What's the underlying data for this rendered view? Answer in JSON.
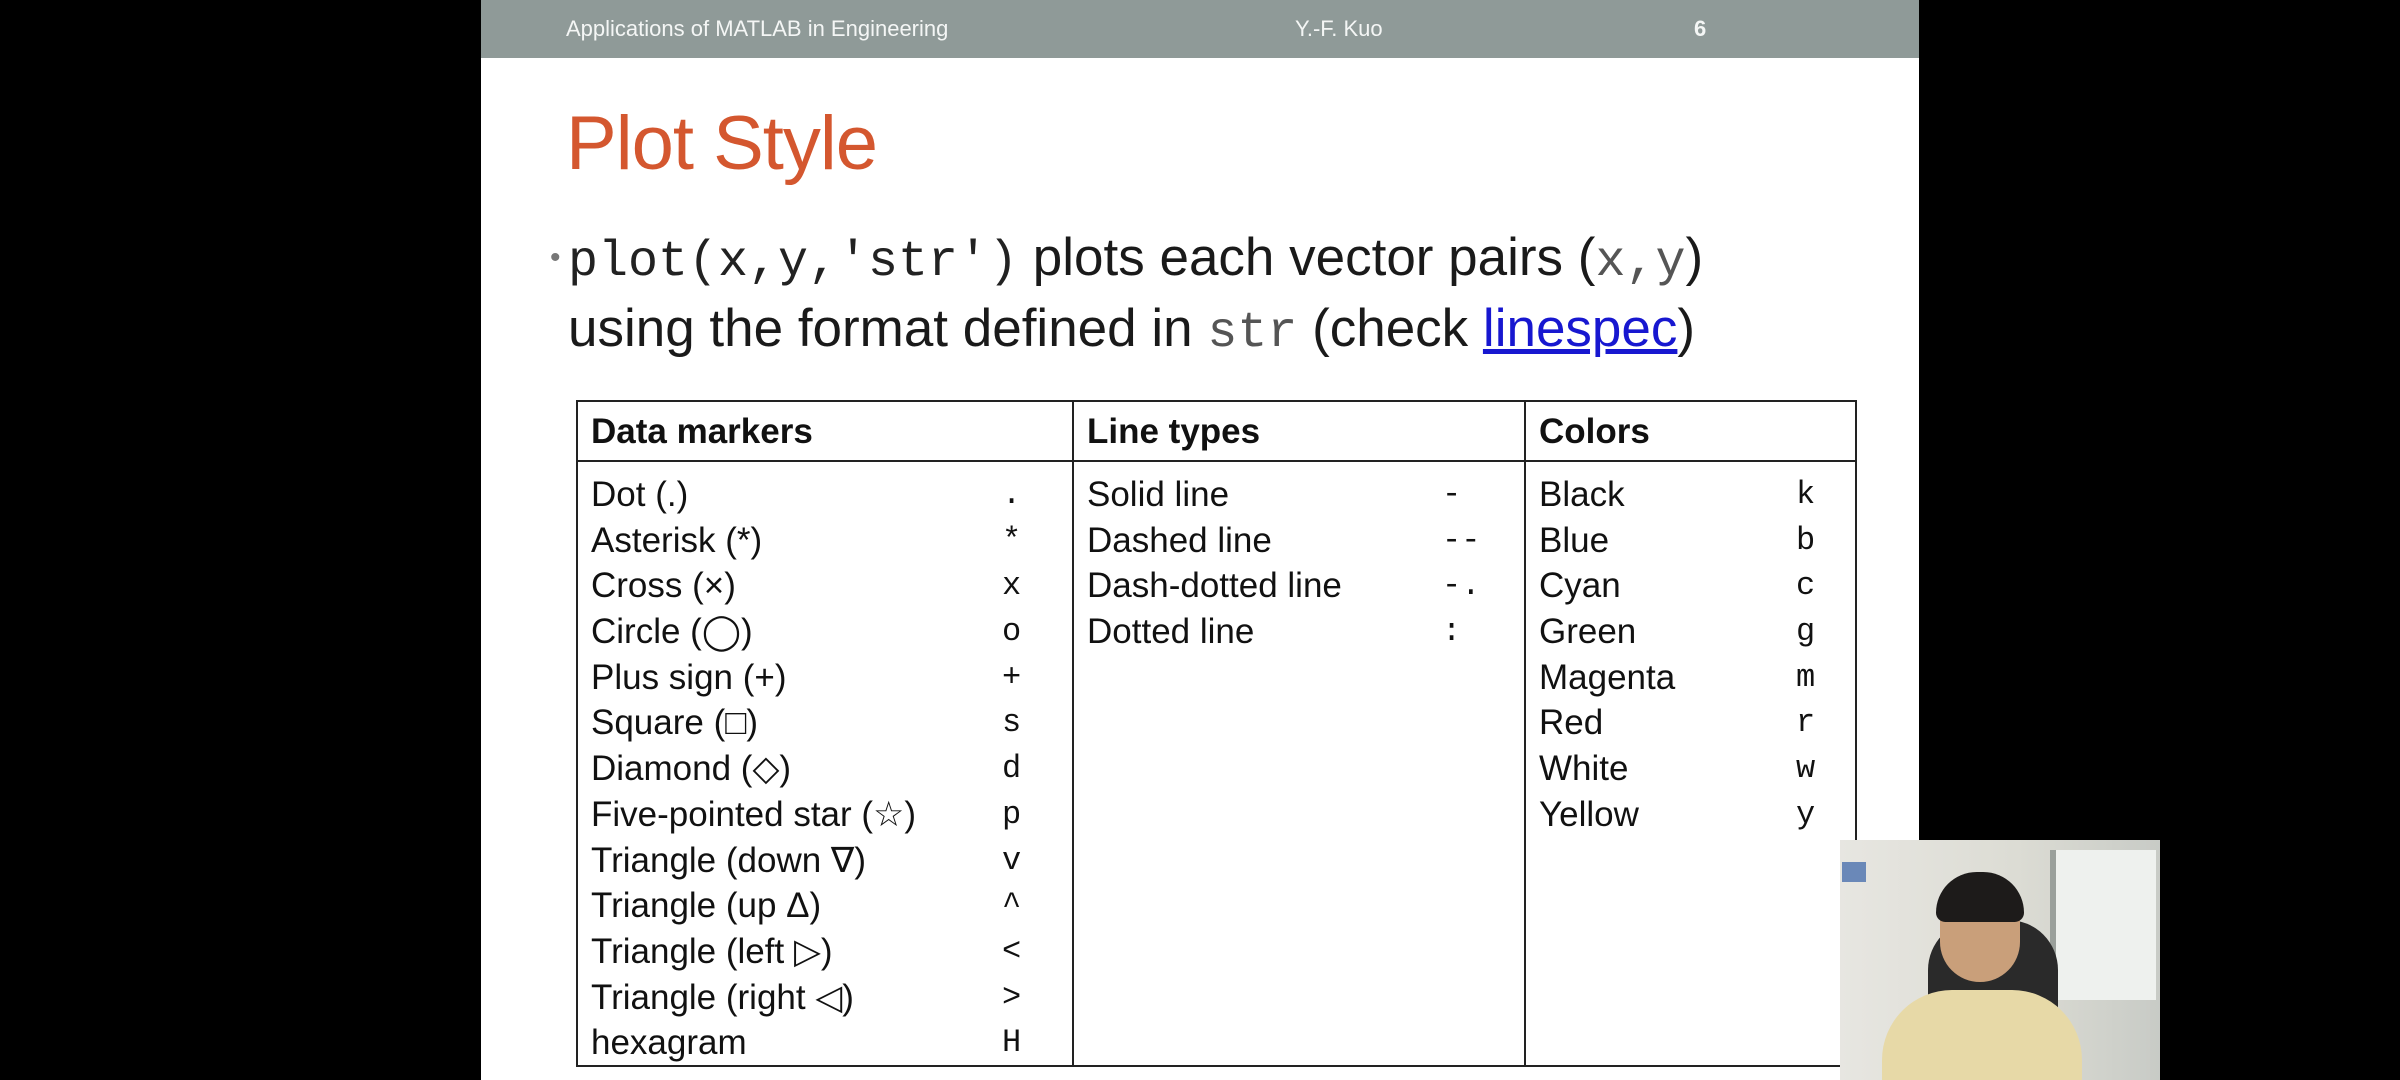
{
  "header": {
    "course": "Applications of MATLAB in Engineering",
    "author": "Y.-F. Kuo",
    "page": "6"
  },
  "title": "Plot Style",
  "bullet": {
    "code1": "plot(x,y,'str')",
    "text1": " plots each vector pairs (",
    "code2": "x,y",
    "text2": ")",
    "text3": "using the format defined in ",
    "code3": "str",
    "text4": "  (check ",
    "link": "linespec",
    "text5": ")"
  },
  "table": {
    "markers_header": "Data markers",
    "lines_header": "Line types",
    "colors_header": "Colors",
    "markers": [
      {
        "label": "Dot (.)",
        "code": "."
      },
      {
        "label": "Asterisk (*)",
        "code": "*"
      },
      {
        "label": "Cross (×)",
        "code": "x"
      },
      {
        "label": "Circle (◯)",
        "code": "o"
      },
      {
        "label": "Plus sign (+)",
        "code": "+"
      },
      {
        "label": "Square (□)",
        "code": "s"
      },
      {
        "label": "Diamond (◇)",
        "code": "d"
      },
      {
        "label": "Five-pointed star (☆)",
        "code": "p"
      },
      {
        "label": "Triangle (down ∇)",
        "code": "v"
      },
      {
        "label": "Triangle (up Δ)",
        "code": "^"
      },
      {
        "label": "Triangle (left ▷)",
        "code": "<"
      },
      {
        "label": "Triangle (right ◁)",
        "code": ">"
      },
      {
        "label": "hexagram",
        "code": "H"
      }
    ],
    "lines": [
      {
        "label": "Solid line",
        "code": "-"
      },
      {
        "label": "Dashed line",
        "code": "--"
      },
      {
        "label": "Dash-dotted line",
        "code": "-."
      },
      {
        "label": "Dotted line",
        "code": ":"
      }
    ],
    "colors": [
      {
        "label": "Black",
        "code": "k"
      },
      {
        "label": "Blue",
        "code": "b"
      },
      {
        "label": "Cyan",
        "code": "c"
      },
      {
        "label": "Green",
        "code": "g"
      },
      {
        "label": "Magenta",
        "code": "m"
      },
      {
        "label": "Red",
        "code": "r"
      },
      {
        "label": "White",
        "code": "w"
      },
      {
        "label": "Yellow",
        "code": "y"
      }
    ]
  },
  "theme": {
    "title_color": "#d4572f",
    "header_bar_color": "#8f9a98",
    "link_color": "#1717d0"
  }
}
